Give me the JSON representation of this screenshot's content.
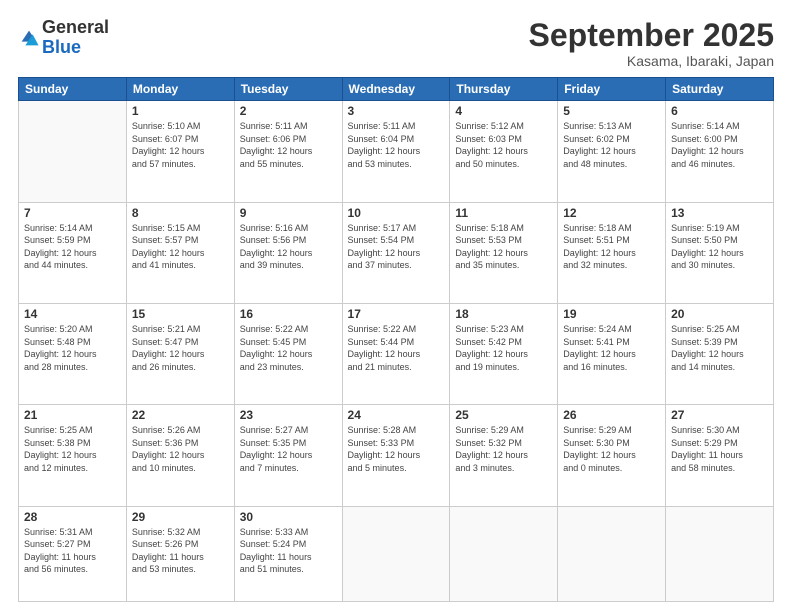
{
  "logo": {
    "general": "General",
    "blue": "Blue"
  },
  "header": {
    "month": "September 2025",
    "location": "Kasama, Ibaraki, Japan"
  },
  "days_of_week": [
    "Sunday",
    "Monday",
    "Tuesday",
    "Wednesday",
    "Thursday",
    "Friday",
    "Saturday"
  ],
  "weeks": [
    [
      {
        "day": "",
        "info": ""
      },
      {
        "day": "1",
        "info": "Sunrise: 5:10 AM\nSunset: 6:07 PM\nDaylight: 12 hours\nand 57 minutes."
      },
      {
        "day": "2",
        "info": "Sunrise: 5:11 AM\nSunset: 6:06 PM\nDaylight: 12 hours\nand 55 minutes."
      },
      {
        "day": "3",
        "info": "Sunrise: 5:11 AM\nSunset: 6:04 PM\nDaylight: 12 hours\nand 53 minutes."
      },
      {
        "day": "4",
        "info": "Sunrise: 5:12 AM\nSunset: 6:03 PM\nDaylight: 12 hours\nand 50 minutes."
      },
      {
        "day": "5",
        "info": "Sunrise: 5:13 AM\nSunset: 6:02 PM\nDaylight: 12 hours\nand 48 minutes."
      },
      {
        "day": "6",
        "info": "Sunrise: 5:14 AM\nSunset: 6:00 PM\nDaylight: 12 hours\nand 46 minutes."
      }
    ],
    [
      {
        "day": "7",
        "info": "Sunrise: 5:14 AM\nSunset: 5:59 PM\nDaylight: 12 hours\nand 44 minutes."
      },
      {
        "day": "8",
        "info": "Sunrise: 5:15 AM\nSunset: 5:57 PM\nDaylight: 12 hours\nand 41 minutes."
      },
      {
        "day": "9",
        "info": "Sunrise: 5:16 AM\nSunset: 5:56 PM\nDaylight: 12 hours\nand 39 minutes."
      },
      {
        "day": "10",
        "info": "Sunrise: 5:17 AM\nSunset: 5:54 PM\nDaylight: 12 hours\nand 37 minutes."
      },
      {
        "day": "11",
        "info": "Sunrise: 5:18 AM\nSunset: 5:53 PM\nDaylight: 12 hours\nand 35 minutes."
      },
      {
        "day": "12",
        "info": "Sunrise: 5:18 AM\nSunset: 5:51 PM\nDaylight: 12 hours\nand 32 minutes."
      },
      {
        "day": "13",
        "info": "Sunrise: 5:19 AM\nSunset: 5:50 PM\nDaylight: 12 hours\nand 30 minutes."
      }
    ],
    [
      {
        "day": "14",
        "info": "Sunrise: 5:20 AM\nSunset: 5:48 PM\nDaylight: 12 hours\nand 28 minutes."
      },
      {
        "day": "15",
        "info": "Sunrise: 5:21 AM\nSunset: 5:47 PM\nDaylight: 12 hours\nand 26 minutes."
      },
      {
        "day": "16",
        "info": "Sunrise: 5:22 AM\nSunset: 5:45 PM\nDaylight: 12 hours\nand 23 minutes."
      },
      {
        "day": "17",
        "info": "Sunrise: 5:22 AM\nSunset: 5:44 PM\nDaylight: 12 hours\nand 21 minutes."
      },
      {
        "day": "18",
        "info": "Sunrise: 5:23 AM\nSunset: 5:42 PM\nDaylight: 12 hours\nand 19 minutes."
      },
      {
        "day": "19",
        "info": "Sunrise: 5:24 AM\nSunset: 5:41 PM\nDaylight: 12 hours\nand 16 minutes."
      },
      {
        "day": "20",
        "info": "Sunrise: 5:25 AM\nSunset: 5:39 PM\nDaylight: 12 hours\nand 14 minutes."
      }
    ],
    [
      {
        "day": "21",
        "info": "Sunrise: 5:25 AM\nSunset: 5:38 PM\nDaylight: 12 hours\nand 12 minutes."
      },
      {
        "day": "22",
        "info": "Sunrise: 5:26 AM\nSunset: 5:36 PM\nDaylight: 12 hours\nand 10 minutes."
      },
      {
        "day": "23",
        "info": "Sunrise: 5:27 AM\nSunset: 5:35 PM\nDaylight: 12 hours\nand 7 minutes."
      },
      {
        "day": "24",
        "info": "Sunrise: 5:28 AM\nSunset: 5:33 PM\nDaylight: 12 hours\nand 5 minutes."
      },
      {
        "day": "25",
        "info": "Sunrise: 5:29 AM\nSunset: 5:32 PM\nDaylight: 12 hours\nand 3 minutes."
      },
      {
        "day": "26",
        "info": "Sunrise: 5:29 AM\nSunset: 5:30 PM\nDaylight: 12 hours\nand 0 minutes."
      },
      {
        "day": "27",
        "info": "Sunrise: 5:30 AM\nSunset: 5:29 PM\nDaylight: 11 hours\nand 58 minutes."
      }
    ],
    [
      {
        "day": "28",
        "info": "Sunrise: 5:31 AM\nSunset: 5:27 PM\nDaylight: 11 hours\nand 56 minutes."
      },
      {
        "day": "29",
        "info": "Sunrise: 5:32 AM\nSunset: 5:26 PM\nDaylight: 11 hours\nand 53 minutes."
      },
      {
        "day": "30",
        "info": "Sunrise: 5:33 AM\nSunset: 5:24 PM\nDaylight: 11 hours\nand 51 minutes."
      },
      {
        "day": "",
        "info": ""
      },
      {
        "day": "",
        "info": ""
      },
      {
        "day": "",
        "info": ""
      },
      {
        "day": "",
        "info": ""
      }
    ]
  ]
}
